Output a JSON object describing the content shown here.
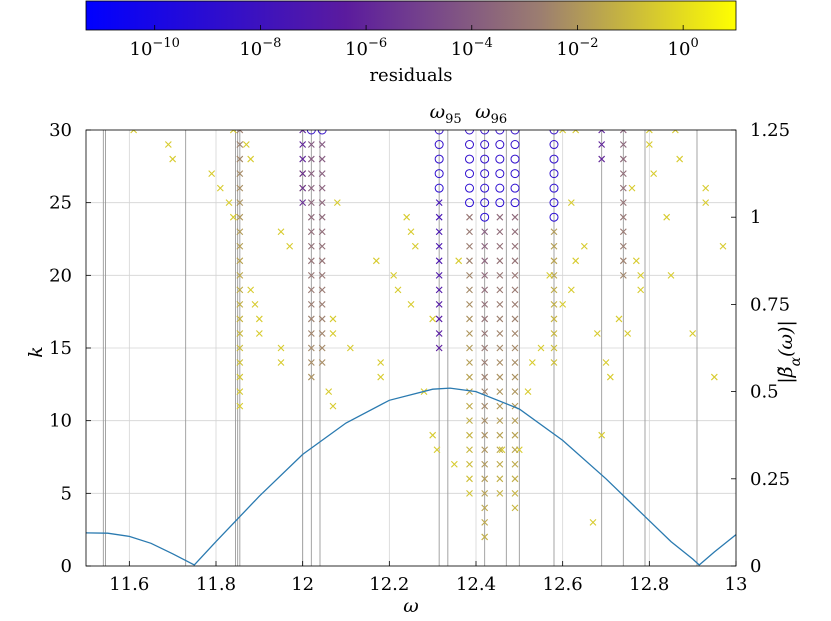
{
  "colorbar": {
    "label": "residuals",
    "colors": [
      "#0000ff",
      "#5b1b9e",
      "#9c7e70",
      "#ffff00"
    ],
    "ticks": [
      {
        "base": "10",
        "exp": "−10",
        "log": -10
      },
      {
        "base": "10",
        "exp": "−8",
        "log": -8
      },
      {
        "base": "10",
        "exp": "−6",
        "log": -6
      },
      {
        "base": "10",
        "exp": "−4",
        "log": -4
      },
      {
        "base": "10",
        "exp": "−2",
        "log": -2
      },
      {
        "base": "10",
        "exp": "0",
        "log": 0
      }
    ],
    "range_log": [
      -11.3,
      1
    ]
  },
  "chart_data": {
    "type": "scatter",
    "xlabel": "ω",
    "ylabel": "k",
    "y2label": "|β̃α(ω)|",
    "xlim": [
      11.5,
      13
    ],
    "ylim": [
      0,
      30
    ],
    "y2lim": [
      0,
      1.25
    ],
    "xticks": [
      "11.6",
      "11.8",
      "12",
      "12.2",
      "12.4",
      "12.6",
      "12.8",
      "13"
    ],
    "xtick_values": [
      11.6,
      11.8,
      12.0,
      12.2,
      12.4,
      12.6,
      12.8,
      13.0
    ],
    "yticks": [
      "0",
      "5",
      "10",
      "15",
      "20",
      "25",
      "30"
    ],
    "ytick_values": [
      0,
      5,
      10,
      15,
      20,
      25,
      30
    ],
    "y2ticks": [
      "0",
      "0.25",
      "0.5",
      "0.75",
      "1",
      "1.25"
    ],
    "y2tick_values": [
      0,
      0.25,
      0.5,
      0.75,
      1,
      1.25
    ],
    "grid": true,
    "annotations": [
      {
        "text_base": "ω",
        "text_sub": "95",
        "x": 12.33
      },
      {
        "text_base": "ω",
        "text_sub": "96",
        "x": 12.435
      }
    ],
    "vertical_lines": [
      11.54,
      11.545,
      11.73,
      11.845,
      11.85,
      11.855,
      12.0,
      12.02,
      12.04,
      12.315,
      12.335,
      12.42,
      12.47,
      12.5,
      12.58,
      12.69,
      12.74,
      12.79,
      12.91
    ],
    "curve": {
      "name": "|β̃α(ω)|",
      "color": "#2a7ab0",
      "x": [
        11.5,
        11.55,
        11.6,
        11.65,
        11.7,
        11.75,
        11.8,
        11.9,
        12.0,
        12.1,
        12.2,
        12.3,
        12.34,
        12.4,
        12.5,
        12.6,
        12.7,
        12.8,
        12.85,
        12.9,
        12.915,
        12.95,
        13.0
      ],
      "y": [
        0.095,
        0.094,
        0.085,
        0.065,
        0.035,
        0.003,
        0.07,
        0.2,
        0.32,
        0.41,
        0.475,
        0.507,
        0.51,
        0.5,
        0.45,
        0.36,
        0.25,
        0.13,
        0.07,
        0.02,
        0.003,
        0.04,
        0.09
      ]
    },
    "circle_columns": [
      {
        "x": 12.02,
        "k": [
          30
        ]
      },
      {
        "x": 12.045,
        "k": [
          30
        ]
      },
      {
        "x": 12.315,
        "k": [
          26,
          27,
          28,
          29,
          30
        ]
      },
      {
        "x": 12.385,
        "k": [
          25,
          26,
          27,
          28,
          29,
          30
        ]
      },
      {
        "x": 12.42,
        "k": [
          24,
          25,
          26,
          27,
          28,
          29,
          30
        ]
      },
      {
        "x": 12.455,
        "k": [
          25,
          26,
          27,
          28,
          29,
          30
        ]
      },
      {
        "x": 12.49,
        "k": [
          25,
          26,
          27,
          28,
          29,
          30
        ]
      },
      {
        "x": 12.58,
        "k": [
          24,
          25,
          26,
          27,
          28,
          29,
          30
        ]
      }
    ],
    "cross_columns": [
      {
        "x": 11.855,
        "k": [
          11,
          12,
          13,
          14,
          15,
          16,
          17,
          18,
          19,
          20,
          21,
          22,
          23,
          24,
          25,
          26,
          27,
          28,
          29,
          30
        ],
        "log": -1.5
      },
      {
        "x": 12.0,
        "k": [
          25,
          26,
          27,
          28,
          29,
          30
        ],
        "log": -5
      },
      {
        "x": 12.02,
        "k": [
          13,
          14,
          15,
          16,
          17,
          18,
          19,
          20,
          21,
          22,
          23,
          24,
          25,
          26,
          27,
          28,
          29
        ],
        "log": -3
      },
      {
        "x": 12.045,
        "k": [
          14,
          15,
          16,
          17,
          18,
          19,
          20,
          21,
          22,
          23,
          24,
          25,
          26,
          27,
          28,
          29
        ],
        "log": -3
      },
      {
        "x": 12.315,
        "k": [
          15,
          16,
          17,
          18,
          19,
          20,
          21,
          22,
          23,
          24,
          25
        ],
        "log": -7
      },
      {
        "x": 12.385,
        "k": [
          5,
          6,
          7,
          8,
          9,
          10,
          11,
          12,
          13,
          14,
          15,
          16,
          17,
          18,
          19,
          20,
          21,
          22,
          23,
          24
        ],
        "log": -2.5
      },
      {
        "x": 12.42,
        "k": [
          2,
          3,
          4,
          5,
          6,
          7,
          8,
          9,
          10,
          11,
          12,
          13,
          14,
          15,
          16,
          17,
          18,
          19,
          20,
          21,
          22,
          23
        ],
        "log": -3.5
      },
      {
        "x": 12.455,
        "k": [
          5,
          6,
          7,
          8,
          9,
          10,
          11,
          12,
          13,
          14,
          15,
          16,
          17,
          18,
          19,
          20,
          21,
          22,
          23,
          24
        ],
        "log": -3
      },
      {
        "x": 12.49,
        "k": [
          4,
          5,
          6,
          7,
          8,
          9,
          10,
          11,
          12,
          13,
          14,
          15,
          16,
          17,
          18,
          19,
          20,
          21,
          22,
          23,
          24
        ],
        "log": -3
      },
      {
        "x": 12.58,
        "k": [
          14,
          15,
          16,
          17,
          18,
          19,
          20,
          21,
          22,
          23
        ],
        "log": -1.5
      },
      {
        "x": 12.69,
        "k": [
          28,
          29,
          30
        ],
        "log": -5
      },
      {
        "x": 12.74,
        "k": [
          20,
          21,
          22,
          23,
          24,
          25,
          26,
          27,
          28,
          29,
          30
        ],
        "log": -2.5
      }
    ],
    "scattered_crosses": [
      [
        11.61,
        30
      ],
      [
        11.69,
        29
      ],
      [
        11.7,
        28
      ],
      [
        11.79,
        27
      ],
      [
        11.81,
        26
      ],
      [
        11.83,
        25
      ],
      [
        11.84,
        24
      ],
      [
        11.84,
        30
      ],
      [
        11.87,
        29
      ],
      [
        11.88,
        28
      ],
      [
        11.88,
        19
      ],
      [
        11.89,
        18
      ],
      [
        11.9,
        17
      ],
      [
        11.9,
        16
      ],
      [
        11.95,
        15
      ],
      [
        11.95,
        14
      ],
      [
        11.95,
        23
      ],
      [
        11.97,
        22
      ],
      [
        12.0,
        27
      ],
      [
        12.0,
        26
      ],
      [
        12.08,
        25
      ],
      [
        12.07,
        17
      ],
      [
        12.07,
        16
      ],
      [
        12.06,
        12
      ],
      [
        12.07,
        11
      ],
      [
        12.11,
        15
      ],
      [
        12.17,
        21
      ],
      [
        12.18,
        14
      ],
      [
        12.18,
        13
      ],
      [
        12.21,
        20
      ],
      [
        12.22,
        19
      ],
      [
        12.25,
        18
      ],
      [
        12.24,
        24
      ],
      [
        12.25,
        23
      ],
      [
        12.26,
        22
      ],
      [
        12.3,
        17
      ],
      [
        12.28,
        12
      ],
      [
        12.3,
        9
      ],
      [
        12.31,
        8
      ],
      [
        12.35,
        7
      ],
      [
        12.36,
        21
      ],
      [
        12.46,
        8
      ],
      [
        12.5,
        8
      ],
      [
        12.52,
        12
      ],
      [
        12.53,
        14
      ],
      [
        12.55,
        15
      ],
      [
        12.57,
        20
      ],
      [
        12.6,
        18
      ],
      [
        12.62,
        19
      ],
      [
        12.62,
        25
      ],
      [
        12.63,
        21
      ],
      [
        12.65,
        22
      ],
      [
        12.6,
        30
      ],
      [
        12.63,
        30
      ],
      [
        12.67,
        3
      ],
      [
        12.68,
        16
      ],
      [
        12.69,
        9
      ],
      [
        12.7,
        14
      ],
      [
        12.71,
        13
      ],
      [
        12.73,
        17
      ],
      [
        12.75,
        16
      ],
      [
        12.76,
        26
      ],
      [
        12.77,
        21
      ],
      [
        12.78,
        20
      ],
      [
        12.78,
        19
      ],
      [
        12.8,
        30
      ],
      [
        12.8,
        29
      ],
      [
        12.81,
        27
      ],
      [
        12.84,
        24
      ],
      [
        12.85,
        20
      ],
      [
        12.86,
        30
      ],
      [
        12.87,
        28
      ],
      [
        12.9,
        16
      ],
      [
        12.93,
        26
      ],
      [
        12.93,
        25
      ],
      [
        12.95,
        13
      ],
      [
        12.97,
        22
      ]
    ]
  }
}
